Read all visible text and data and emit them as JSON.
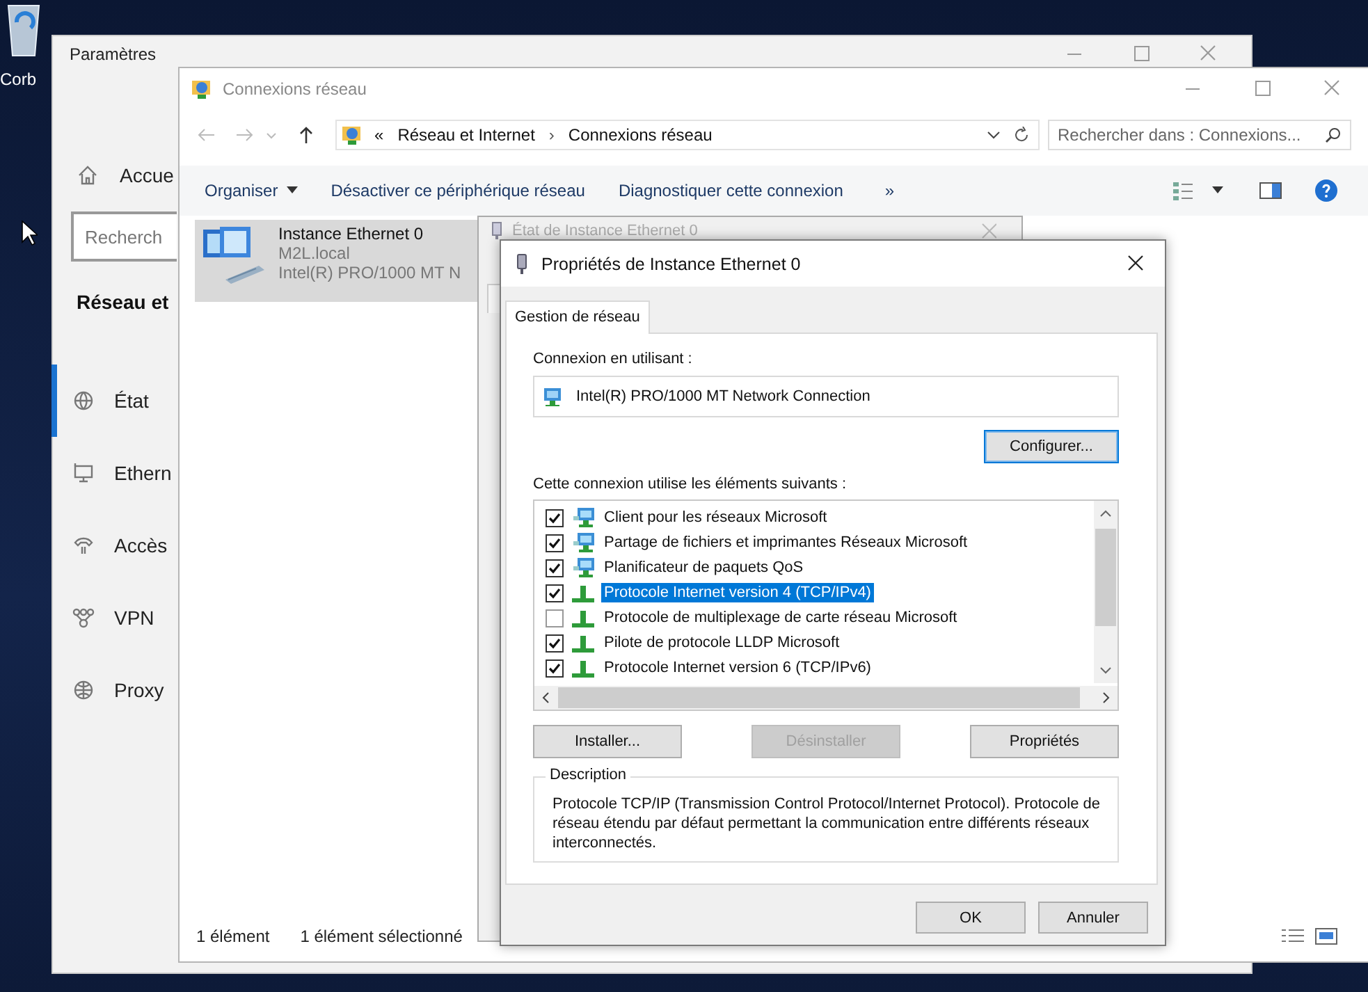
{
  "desktop": {
    "icon_label": "Corb"
  },
  "settings_window": {
    "title": "Paramètres",
    "home_label": "Accue",
    "search": {
      "placeholder": "Recherch"
    },
    "section_title": "Réseau et",
    "nav": [
      {
        "label": "État",
        "kind": "status",
        "selected": true
      },
      {
        "label": "Ethern",
        "kind": "ethernet",
        "selected": false
      },
      {
        "label": "Accès",
        "kind": "dialup",
        "selected": false
      },
      {
        "label": "VPN",
        "kind": "vpn",
        "selected": false
      },
      {
        "label": "Proxy",
        "kind": "proxy",
        "selected": false
      }
    ]
  },
  "explorer_window": {
    "title": "Connexions réseau",
    "overflow_mark": "«",
    "separator": "›",
    "breadcrumb": [
      "Réseau et Internet",
      "Connexions réseau"
    ],
    "search": {
      "placeholder": "Rechercher dans : Connexions..."
    },
    "toolbar": [
      {
        "label": "Organiser",
        "kind": "menu"
      },
      {
        "label": "Désactiver ce périphérique réseau",
        "kind": "command"
      },
      {
        "label": "Diagnostiquer cette connexion",
        "kind": "command"
      },
      {
        "label": "»",
        "kind": "more"
      }
    ],
    "items": [
      {
        "name": "Instance Ethernet 0",
        "domain": "M2L.local",
        "adapter": "Intel(R) PRO/1000 MT N",
        "selected": true
      }
    ],
    "status_bar": [
      "1 élément",
      "1 élément sélectionné"
    ]
  },
  "status_window": {
    "title": "État de Instance Ethernet 0"
  },
  "properties_dialog": {
    "title": "Propriétés de Instance Ethernet 0",
    "tabs": [
      {
        "label": "Gestion de réseau",
        "selected": true
      }
    ],
    "connect_using_label": "Connexion en utilisant :",
    "adapter": "Intel(R) PRO/1000 MT Network Connection",
    "configure_button": "Configurer...",
    "components_label": "Cette connexion utilise les éléments suivants :",
    "components": [
      {
        "label": "Client pour les réseaux Microsoft",
        "kind": "service",
        "checked": true,
        "selected": false
      },
      {
        "label": "Partage de fichiers et imprimantes Réseaux Microsoft",
        "kind": "service",
        "checked": true,
        "selected": false
      },
      {
        "label": "Planificateur de paquets QoS",
        "kind": "service",
        "checked": true,
        "selected": false
      },
      {
        "label": "Protocole Internet version 4 (TCP/IPv4)",
        "kind": "protocol",
        "checked": true,
        "selected": true
      },
      {
        "label": "Protocole de multiplexage de carte réseau Microsoft",
        "kind": "protocol",
        "checked": false,
        "selected": false
      },
      {
        "label": "Pilote de protocole LLDP Microsoft",
        "kind": "protocol",
        "checked": true,
        "selected": false
      },
      {
        "label": "Protocole Internet version 6 (TCP/IPv6)",
        "kind": "protocol",
        "checked": true,
        "selected": false
      }
    ],
    "buttons": [
      {
        "label": "Installer...",
        "disabled": false
      },
      {
        "label": "Désinstaller",
        "disabled": true
      },
      {
        "label": "Propriétés",
        "disabled": false
      }
    ],
    "description": {
      "legend": "Description",
      "text": "Protocole TCP/IP (Transmission Control Protocol/Internet Protocol). Protocole de réseau étendu par défaut permettant la communication entre différents réseaux interconnectés."
    },
    "footer_buttons": [
      "OK",
      "Annuler"
    ]
  }
}
